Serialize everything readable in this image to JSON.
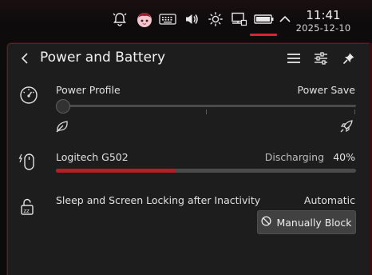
{
  "tray": {
    "icons": [
      "notifications-disabled-icon",
      "avatar-icon",
      "keyboard-icon",
      "volume-icon",
      "brightness-icon",
      "network-icon",
      "battery-icon",
      "expand-tray-icon"
    ],
    "clock": {
      "time": "11:41",
      "date": "2025-12-10"
    },
    "accent_color": "#d9232e"
  },
  "popup": {
    "title": "Power and Battery",
    "header_icons": [
      "back-arrow-icon",
      "menu-icon",
      "configure-icon",
      "pin-icon"
    ],
    "power_profile": {
      "label": "Power Profile",
      "value": "Power Save",
      "left_icon": "leaf-icon",
      "right_icon": "rocket-icon",
      "level": 0
    },
    "device": {
      "name": "Logitech G502",
      "status": "Discharging",
      "percent": "40%",
      "charge": 0.4,
      "bar_color": "#b31f26"
    },
    "sleep": {
      "label": "Sleep and Screen Locking after Inactivity",
      "value": "Automatic",
      "button_label": "Manually Block"
    }
  }
}
